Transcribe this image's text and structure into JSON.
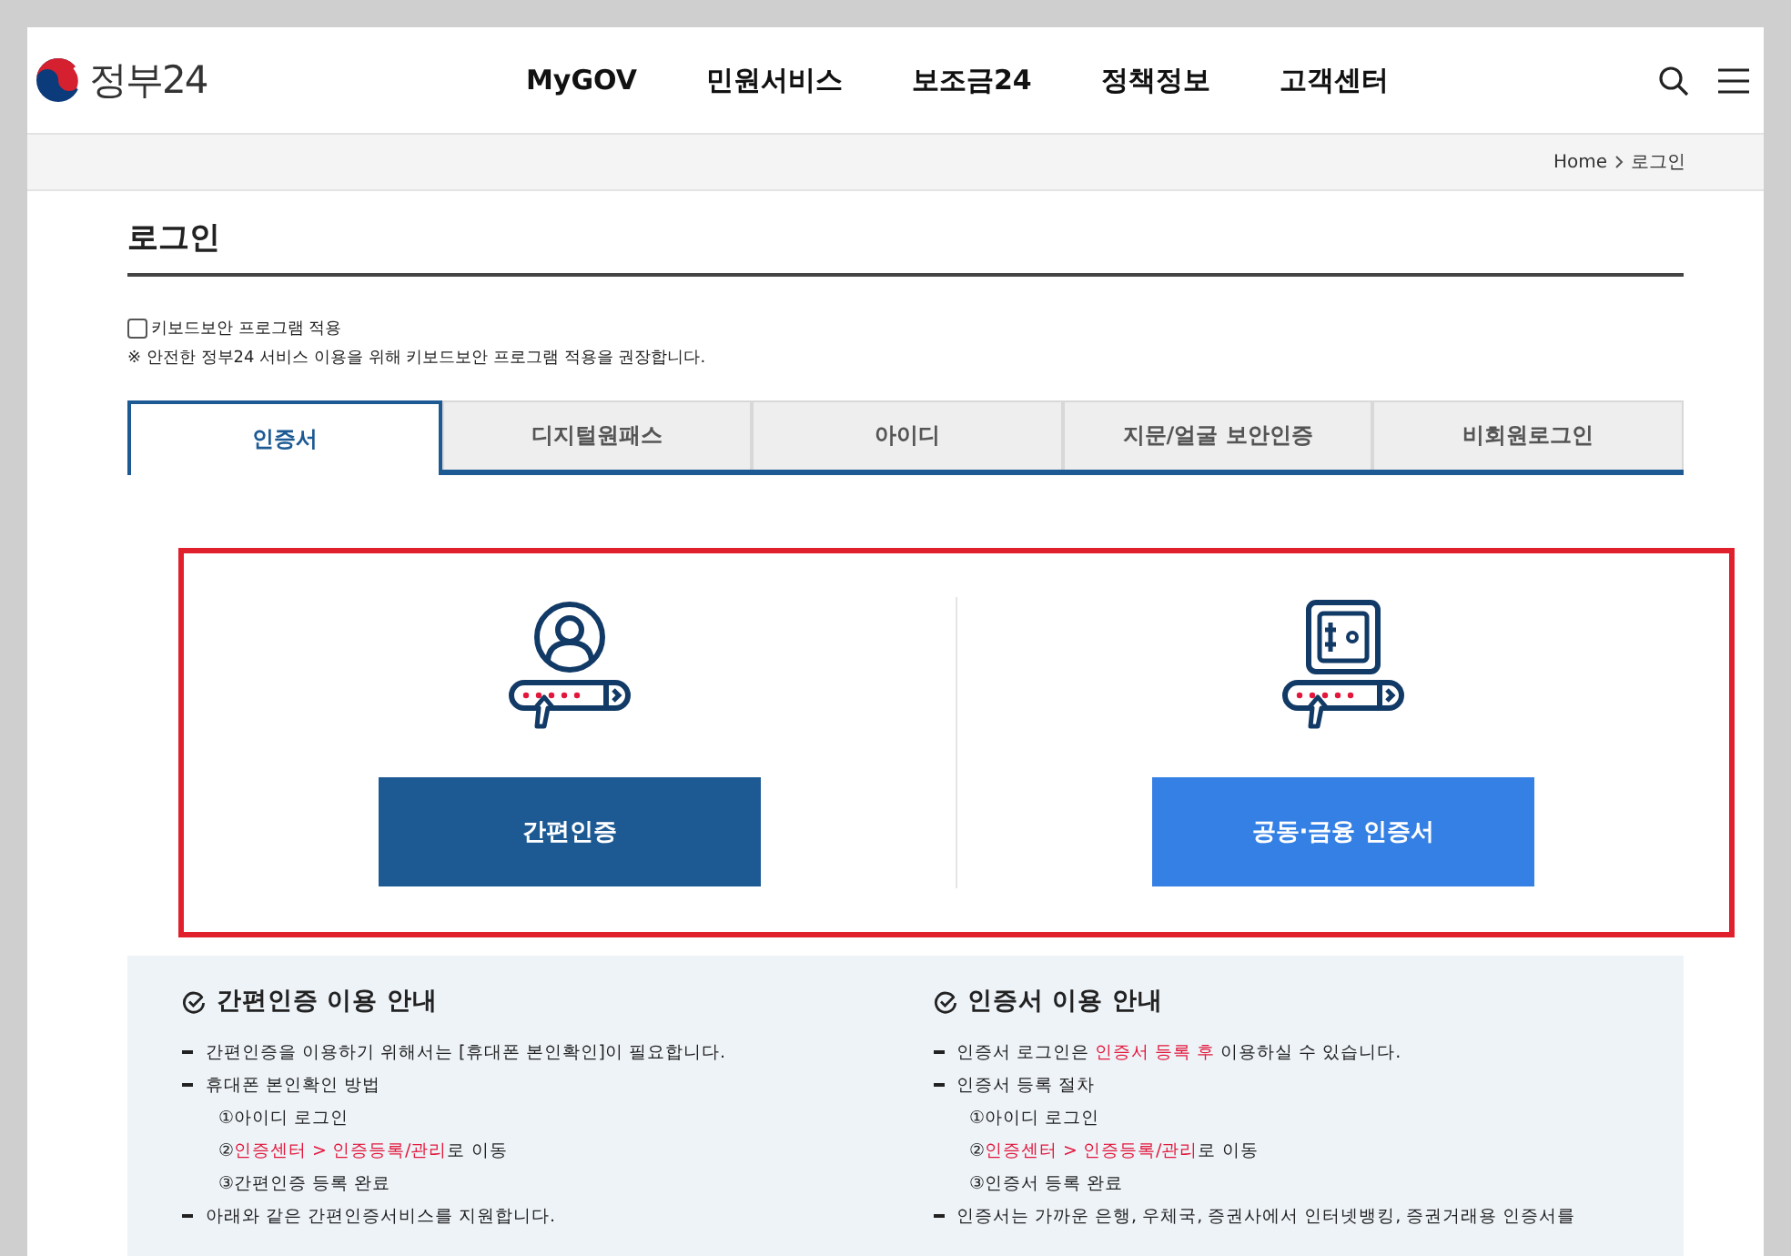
{
  "header": {
    "logo_text": "정부24",
    "nav": [
      "MyGOV",
      "민원서비스",
      "보조금24",
      "정책정보",
      "고객센터"
    ]
  },
  "breadcrumb": [
    "Home",
    "로그인"
  ],
  "page_title": "로그인",
  "keyboard_security": {
    "label": "키보드보안 프로그램 적용",
    "checked": false
  },
  "notice": "※ 안전한 정부24 서비스 이용을 위해 키보드보안 프로그램 적용을 권장합니다.",
  "tabs": [
    {
      "label": "인증서",
      "selected": true
    },
    {
      "label": "디지털원패스",
      "selected": false
    },
    {
      "label": "아이디",
      "selected": false
    },
    {
      "label": "지문/얼굴 보안인증",
      "selected": false
    },
    {
      "label": "비회원로그인",
      "selected": false
    }
  ],
  "login_options": [
    {
      "kind": "person",
      "button": "간편인증",
      "color": "#1d5a94"
    },
    {
      "kind": "safe",
      "button": "공동·금융 인증서",
      "color": "#3580e4"
    }
  ],
  "guides": [
    {
      "title": "간편인증 이용 안내",
      "items": [
        {
          "kind": "bullet",
          "parts": [
            {
              "text": "간편인증을 이용하기 위해서는 [휴대폰 본인확인]이 필요합니다.",
              "highlight": false
            }
          ]
        },
        {
          "kind": "bullet",
          "parts": [
            {
              "text": "휴대폰 본인확인 방법",
              "highlight": false
            }
          ]
        },
        {
          "kind": "step",
          "parts": [
            {
              "text": "①아이디 로그인",
              "highlight": false
            }
          ]
        },
        {
          "kind": "step",
          "parts": [
            {
              "text": "②",
              "highlight": false
            },
            {
              "text": "인증센터 > 인증등록/관리",
              "highlight": true
            },
            {
              "text": "로 이동",
              "highlight": false
            }
          ]
        },
        {
          "kind": "step",
          "parts": [
            {
              "text": "③간편인증 등록 완료",
              "highlight": false
            }
          ]
        },
        {
          "kind": "bullet",
          "parts": [
            {
              "text": "아래와 같은 간편인증서비스를 지원합니다.",
              "highlight": false
            }
          ]
        }
      ]
    },
    {
      "title": "인증서 이용 안내",
      "items": [
        {
          "kind": "bullet",
          "parts": [
            {
              "text": "인증서 로그인은 ",
              "highlight": false
            },
            {
              "text": "인증서 등록 후",
              "highlight": true
            },
            {
              "text": " 이용하실 수 있습니다.",
              "highlight": false
            }
          ]
        },
        {
          "kind": "bullet",
          "parts": [
            {
              "text": "인증서 등록 절차",
              "highlight": false
            }
          ]
        },
        {
          "kind": "step",
          "parts": [
            {
              "text": "①아이디 로그인",
              "highlight": false
            }
          ]
        },
        {
          "kind": "step",
          "parts": [
            {
              "text": "②",
              "highlight": false
            },
            {
              "text": "인증센터 > 인증등록/관리",
              "highlight": true
            },
            {
              "text": "로 이동",
              "highlight": false
            }
          ]
        },
        {
          "kind": "step",
          "parts": [
            {
              "text": "③인증서 등록 완료",
              "highlight": false
            }
          ]
        },
        {
          "kind": "bullet",
          "parts": [
            {
              "text": "인증서는 가까운 은행, 우체국, 증권사에서 인터넷뱅킹, 증권거래용 인증서를",
              "highlight": false
            }
          ]
        }
      ]
    }
  ]
}
